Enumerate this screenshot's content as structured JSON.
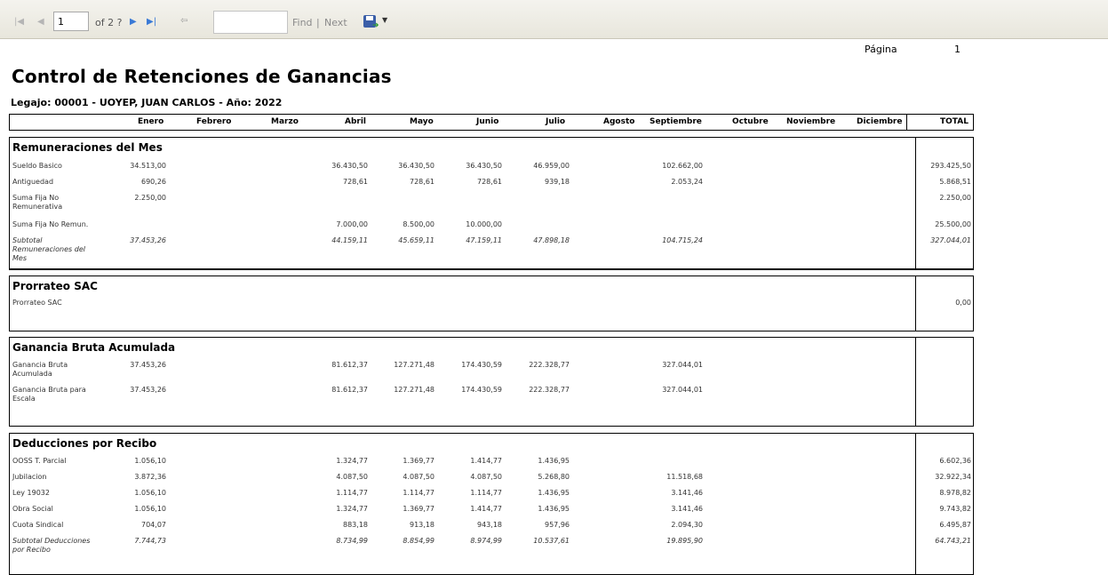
{
  "toolbar": {
    "page_value": "1",
    "page_of": "of 2 ?",
    "find_label": "Find",
    "separator": "|",
    "next_label": "Next",
    "icons": [
      "first-page-icon",
      "previous-page-icon",
      "next-page-icon",
      "last-page-icon",
      "back-icon",
      "export-save-icon",
      "dropdown-arrow-icon"
    ]
  },
  "page": {
    "label": "Página",
    "number": "1"
  },
  "report": {
    "title": "Control de Retenciones de Ganancias",
    "subtitle": "Legajo: 00001 - UOYEP, JUAN CARLOS - Año: 2022",
    "columns": [
      "Enero",
      "Febrero",
      "Marzo",
      "Abril",
      "Mayo",
      "Junio",
      "Julio",
      "Agosto",
      "Septiembre",
      "Octubre",
      "Noviembre",
      "Diciembre",
      "TOTAL"
    ]
  },
  "sections": {
    "remuneraciones": {
      "title": "Remuneraciones del Mes",
      "rows": [
        {
          "label": "Sueldo Basico",
          "Enero": "34.513,00",
          "Abril": "36.430,50",
          "Mayo": "36.430,50",
          "Junio": "36.430,50",
          "Julio": "46.959,00",
          "Septiembre": "102.662,00",
          "TOTAL": "293.425,50"
        },
        {
          "label": "Antiguedad",
          "Enero": "690,26",
          "Abril": "728,61",
          "Mayo": "728,61",
          "Junio": "728,61",
          "Julio": "939,18",
          "Septiembre": "2.053,24",
          "TOTAL": "5.868,51"
        },
        {
          "label": "Suma Fija No Remunerativa",
          "Enero": "2.250,00",
          "TOTAL": "2.250,00"
        },
        {
          "label": "Suma Fija No Remun.",
          "Abril": "7.000,00",
          "Mayo": "8.500,00",
          "Junio": "10.000,00",
          "TOTAL": "25.500,00"
        },
        {
          "label": "Subtotal Remuneraciones del Mes",
          "Enero": "37.453,26",
          "Abril": "44.159,11",
          "Mayo": "45.659,11",
          "Junio": "47.159,11",
          "Julio": "47.898,18",
          "Septiembre": "104.715,24",
          "TOTAL": "327.044,01"
        }
      ]
    },
    "prorrateo": {
      "title": "Prorrateo SAC",
      "rows": [
        {
          "label": "Prorrateo SAC",
          "TOTAL": "0,00"
        }
      ]
    },
    "ganancia": {
      "title": "Ganancia Bruta Acumulada",
      "rows": [
        {
          "label": "Ganancia Bruta Acumulada",
          "Enero": "37.453,26",
          "Abril": "81.612,37",
          "Mayo": "127.271,48",
          "Junio": "174.430,59",
          "Julio": "222.328,77",
          "Septiembre": "327.044,01"
        },
        {
          "label": "Ganancia Bruta para Escala",
          "Enero": "37.453,26",
          "Abril": "81.612,37",
          "Mayo": "127.271,48",
          "Junio": "174.430,59",
          "Julio": "222.328,77",
          "Septiembre": "327.044,01"
        }
      ]
    },
    "deducciones": {
      "title": "Deducciones por Recibo",
      "rows": [
        {
          "label": "OOSS T. Parcial",
          "Enero": "1.056,10",
          "Abril": "1.324,77",
          "Mayo": "1.369,77",
          "Junio": "1.414,77",
          "Julio": "1.436,95",
          "TOTAL": "6.602,36"
        },
        {
          "label": "Jubilacion",
          "Enero": "3.872,36",
          "Abril": "4.087,50",
          "Mayo": "4.087,50",
          "Junio": "4.087,50",
          "Julio": "5.268,80",
          "Septiembre": "11.518,68",
          "TOTAL": "32.922,34"
        },
        {
          "label": "Ley 19032",
          "Enero": "1.056,10",
          "Abril": "1.114,77",
          "Mayo": "1.114,77",
          "Junio": "1.114,77",
          "Julio": "1.436,95",
          "Septiembre": "3.141,46",
          "TOTAL": "8.978,82"
        },
        {
          "label": "Obra Social",
          "Enero": "1.056,10",
          "Abril": "1.324,77",
          "Mayo": "1.369,77",
          "Junio": "1.414,77",
          "Julio": "1.436,95",
          "Septiembre": "3.141,46",
          "TOTAL": "9.743,82"
        },
        {
          "label": "Cuota Sindical",
          "Enero": "704,07",
          "Abril": "883,18",
          "Mayo": "913,18",
          "Junio": "943,18",
          "Julio": "957,96",
          "Septiembre": "2.094,30",
          "TOTAL": "6.495,87"
        },
        {
          "label": "Subtotal Deducciones por Recibo",
          "Enero": "7.744,73",
          "Abril": "8.734,99",
          "Mayo": "8.854,99",
          "Junio": "8.974,99",
          "Julio": "10.537,61",
          "Septiembre": "19.895,90",
          "TOTAL": "64.743,21"
        }
      ]
    }
  }
}
